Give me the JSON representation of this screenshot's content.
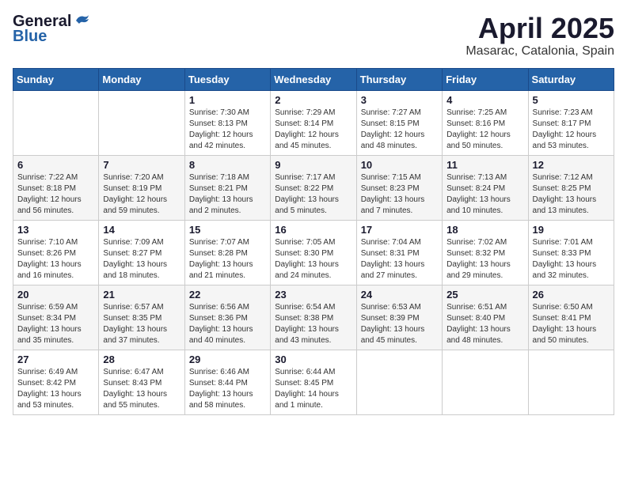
{
  "logo": {
    "general": "General",
    "blue": "Blue"
  },
  "title": {
    "month": "April 2025",
    "location": "Masarac, Catalonia, Spain"
  },
  "weekdays": [
    "Sunday",
    "Monday",
    "Tuesday",
    "Wednesday",
    "Thursday",
    "Friday",
    "Saturday"
  ],
  "weeks": [
    [
      {
        "day": null
      },
      {
        "day": null
      },
      {
        "day": "1",
        "sunrise": "7:30 AM",
        "sunset": "8:13 PM",
        "daylight": "12 hours and 42 minutes."
      },
      {
        "day": "2",
        "sunrise": "7:29 AM",
        "sunset": "8:14 PM",
        "daylight": "12 hours and 45 minutes."
      },
      {
        "day": "3",
        "sunrise": "7:27 AM",
        "sunset": "8:15 PM",
        "daylight": "12 hours and 48 minutes."
      },
      {
        "day": "4",
        "sunrise": "7:25 AM",
        "sunset": "8:16 PM",
        "daylight": "12 hours and 50 minutes."
      },
      {
        "day": "5",
        "sunrise": "7:23 AM",
        "sunset": "8:17 PM",
        "daylight": "12 hours and 53 minutes."
      }
    ],
    [
      {
        "day": "6",
        "sunrise": "7:22 AM",
        "sunset": "8:18 PM",
        "daylight": "12 hours and 56 minutes."
      },
      {
        "day": "7",
        "sunrise": "7:20 AM",
        "sunset": "8:19 PM",
        "daylight": "12 hours and 59 minutes."
      },
      {
        "day": "8",
        "sunrise": "7:18 AM",
        "sunset": "8:21 PM",
        "daylight": "13 hours and 2 minutes."
      },
      {
        "day": "9",
        "sunrise": "7:17 AM",
        "sunset": "8:22 PM",
        "daylight": "13 hours and 5 minutes."
      },
      {
        "day": "10",
        "sunrise": "7:15 AM",
        "sunset": "8:23 PM",
        "daylight": "13 hours and 7 minutes."
      },
      {
        "day": "11",
        "sunrise": "7:13 AM",
        "sunset": "8:24 PM",
        "daylight": "13 hours and 10 minutes."
      },
      {
        "day": "12",
        "sunrise": "7:12 AM",
        "sunset": "8:25 PM",
        "daylight": "13 hours and 13 minutes."
      }
    ],
    [
      {
        "day": "13",
        "sunrise": "7:10 AM",
        "sunset": "8:26 PM",
        "daylight": "13 hours and 16 minutes."
      },
      {
        "day": "14",
        "sunrise": "7:09 AM",
        "sunset": "8:27 PM",
        "daylight": "13 hours and 18 minutes."
      },
      {
        "day": "15",
        "sunrise": "7:07 AM",
        "sunset": "8:28 PM",
        "daylight": "13 hours and 21 minutes."
      },
      {
        "day": "16",
        "sunrise": "7:05 AM",
        "sunset": "8:30 PM",
        "daylight": "13 hours and 24 minutes."
      },
      {
        "day": "17",
        "sunrise": "7:04 AM",
        "sunset": "8:31 PM",
        "daylight": "13 hours and 27 minutes."
      },
      {
        "day": "18",
        "sunrise": "7:02 AM",
        "sunset": "8:32 PM",
        "daylight": "13 hours and 29 minutes."
      },
      {
        "day": "19",
        "sunrise": "7:01 AM",
        "sunset": "8:33 PM",
        "daylight": "13 hours and 32 minutes."
      }
    ],
    [
      {
        "day": "20",
        "sunrise": "6:59 AM",
        "sunset": "8:34 PM",
        "daylight": "13 hours and 35 minutes."
      },
      {
        "day": "21",
        "sunrise": "6:57 AM",
        "sunset": "8:35 PM",
        "daylight": "13 hours and 37 minutes."
      },
      {
        "day": "22",
        "sunrise": "6:56 AM",
        "sunset": "8:36 PM",
        "daylight": "13 hours and 40 minutes."
      },
      {
        "day": "23",
        "sunrise": "6:54 AM",
        "sunset": "8:38 PM",
        "daylight": "13 hours and 43 minutes."
      },
      {
        "day": "24",
        "sunrise": "6:53 AM",
        "sunset": "8:39 PM",
        "daylight": "13 hours and 45 minutes."
      },
      {
        "day": "25",
        "sunrise": "6:51 AM",
        "sunset": "8:40 PM",
        "daylight": "13 hours and 48 minutes."
      },
      {
        "day": "26",
        "sunrise": "6:50 AM",
        "sunset": "8:41 PM",
        "daylight": "13 hours and 50 minutes."
      }
    ],
    [
      {
        "day": "27",
        "sunrise": "6:49 AM",
        "sunset": "8:42 PM",
        "daylight": "13 hours and 53 minutes."
      },
      {
        "day": "28",
        "sunrise": "6:47 AM",
        "sunset": "8:43 PM",
        "daylight": "13 hours and 55 minutes."
      },
      {
        "day": "29",
        "sunrise": "6:46 AM",
        "sunset": "8:44 PM",
        "daylight": "13 hours and 58 minutes."
      },
      {
        "day": "30",
        "sunrise": "6:44 AM",
        "sunset": "8:45 PM",
        "daylight": "14 hours and 1 minute."
      },
      {
        "day": null
      },
      {
        "day": null
      },
      {
        "day": null
      }
    ]
  ]
}
